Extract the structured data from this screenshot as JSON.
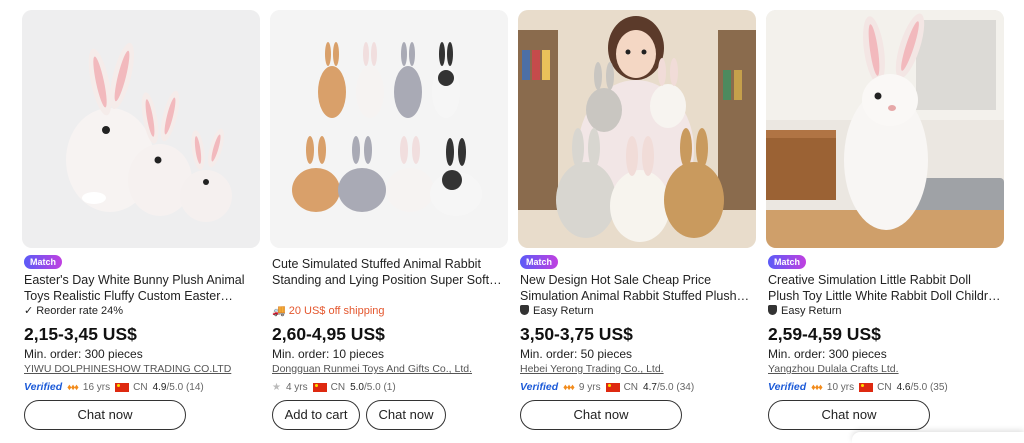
{
  "products": [
    {
      "badge": "Match",
      "title": "Easter's Day White Bunny Plush Animal Toys Realistic Fluffy Custom Easter Bunny...",
      "tagline_icon": "check-icon",
      "tagline": "Reorder rate 24%",
      "price": "2,15-3,45 US$",
      "min_order": "Min. order: 300 pieces",
      "supplier": "YIWU DOLPHINESHOW TRADING CO.LTD",
      "verified": "Verified",
      "years": "16 yrs",
      "country": "CN",
      "rating": "4.9",
      "rating_suffix": "/5.0 (14)",
      "buttons": [
        "Chat now"
      ]
    },
    {
      "badge": "",
      "title": "Cute Simulated Stuffed Animal Rabbit Standing and Lying Position Super Soft Easter Bunny Pillow Rabbit Plush Toy",
      "tagline_icon": "truck-icon",
      "tagline": "20 US$ off shipping",
      "price": "2,60-4,95 US$",
      "min_order": "Min. order: 10 pieces",
      "supplier": "Dongguan Runmei Toys And Gifts Co., Ltd.",
      "verified": "",
      "years": "4 yrs",
      "country": "CN",
      "rating": "5.0",
      "rating_suffix": "/5.0 (1)",
      "buttons": [
        "Add to cart",
        "Chat now"
      ]
    },
    {
      "badge": "Match",
      "title": "New Design Hot Sale Cheap Price Simulation Animal Rabbit Stuffed Plush To...",
      "tagline_icon": "shield-icon",
      "tagline": "Easy Return",
      "price": "3,50-3,75 US$",
      "min_order": "Min. order: 50 pieces",
      "supplier": "Hebei Yerong Trading Co., Ltd.",
      "verified": "Verified",
      "years": "9 yrs",
      "country": "CN",
      "rating": "4.7",
      "rating_suffix": "/5.0 (34)",
      "buttons": [
        "Chat now"
      ]
    },
    {
      "badge": "Match",
      "title": "Creative Simulation Little Rabbit Doll Plush Toy Little White Rabbit Doll Children Slee...",
      "tagline_icon": "shield-icon",
      "tagline": "Easy Return",
      "price": "2,59-4,59 US$",
      "min_order": "Min. order: 300 pieces",
      "supplier": "Yangzhou Dulala Crafts Ltd.",
      "verified": "Verified",
      "years": "10 yrs",
      "country": "CN",
      "rating": "4.6",
      "rating_suffix": "/5.0 (35)",
      "buttons": [
        "Chat now"
      ]
    }
  ],
  "colors": {
    "accent_orange": "#e4572e",
    "verified_blue": "#1d5bd8",
    "match_gradient_start": "#5b5bf7",
    "match_gradient_end": "#c040e0"
  }
}
